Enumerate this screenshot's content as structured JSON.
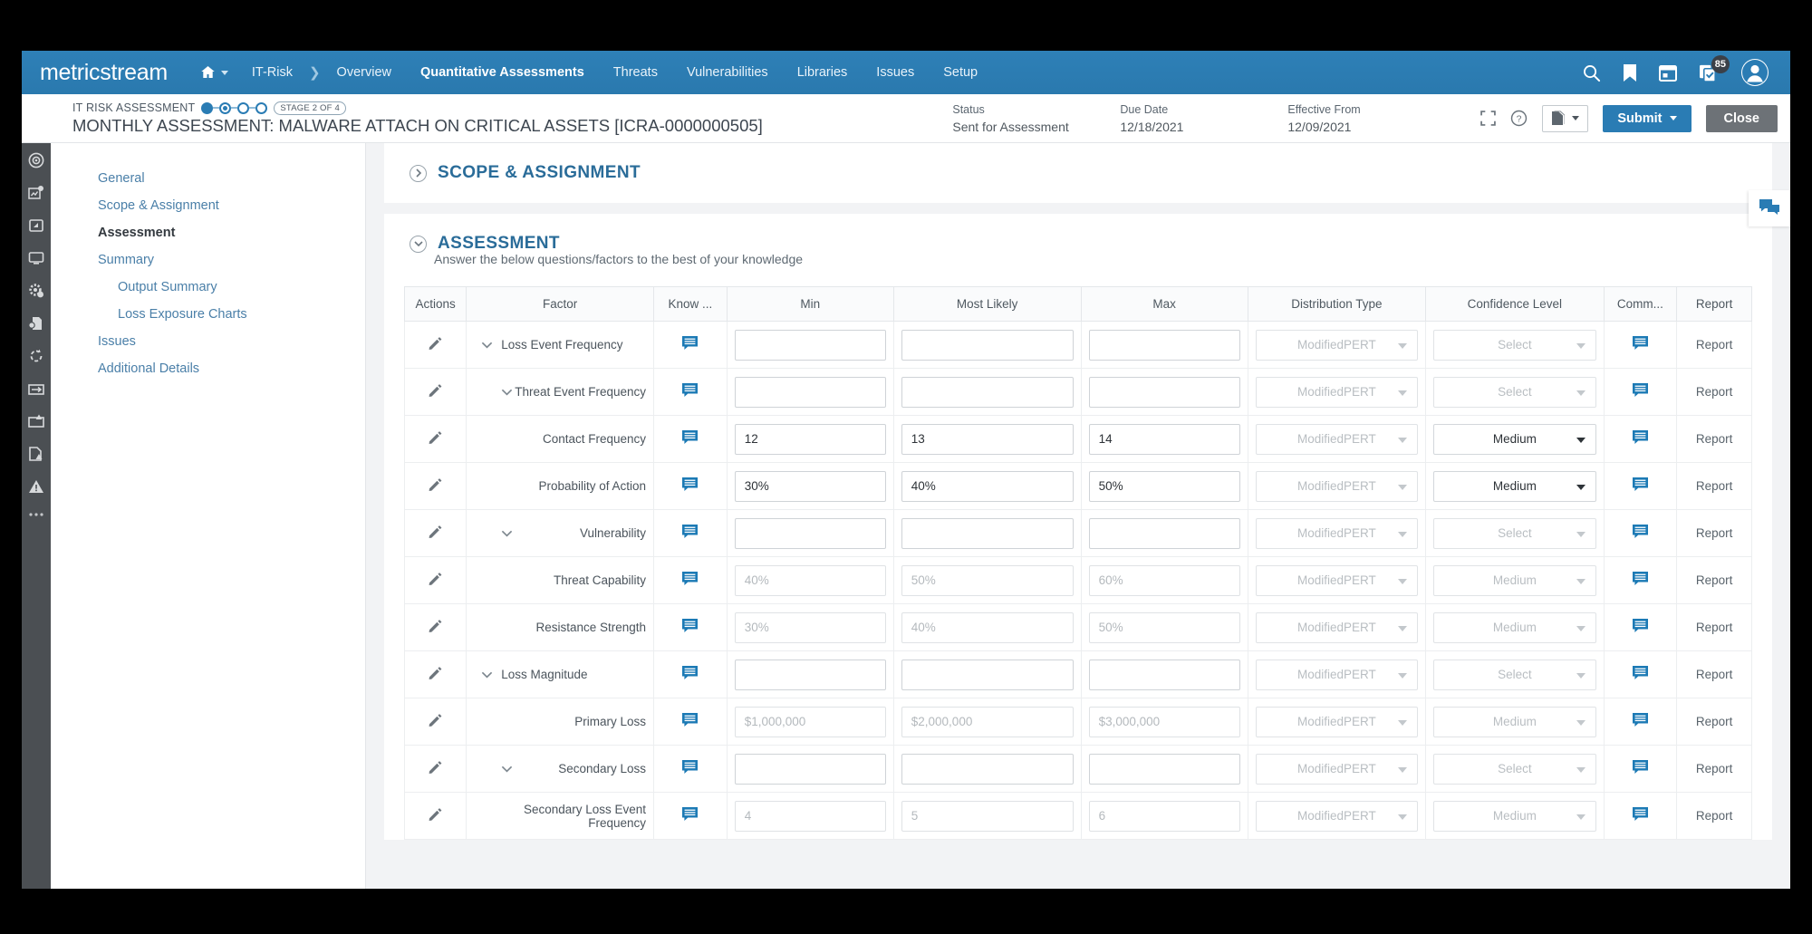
{
  "topnav": {
    "brand": "metricstream",
    "home_label": "home-icon",
    "breadcrumb": [
      "IT-Risk",
      "Overview"
    ],
    "items": [
      {
        "label": "Quantitative Assessments",
        "active": true
      },
      {
        "label": "Threats",
        "active": false
      },
      {
        "label": "Vulnerabilities",
        "active": false
      },
      {
        "label": "Libraries",
        "active": false
      },
      {
        "label": "Issues",
        "active": false
      },
      {
        "label": "Setup",
        "active": false
      }
    ],
    "right_icons": [
      "search-icon",
      "bookmark-icon",
      "calendar-icon",
      "tasks-icon",
      "user-avatar"
    ],
    "task_badge": "85",
    "accent": "#2a7cb4"
  },
  "record_header": {
    "kicker": "IT RISK ASSESSMENT",
    "stage_pill": "STAGE 2 OF 4",
    "stage_total": 4,
    "stage_current": 2,
    "title": "MONTHLY ASSESSMENT: MALWARE ATTACH ON CRITICAL ASSETS [ICRA-0000000505]",
    "meta": [
      {
        "label": "Status",
        "value": "Sent for Assessment"
      },
      {
        "label": "Due Date",
        "value": "12/18/2021"
      },
      {
        "label": "Effective From",
        "value": "12/09/2021"
      }
    ],
    "expand_icon": "expand-icon",
    "help_icon": "help-icon",
    "doc_icon": "document-icon",
    "submit_label": "Submit",
    "close_label": "Close"
  },
  "rail": {
    "icons": [
      "target-icon",
      "risk-assessment-icon",
      "asset-icon",
      "monitor-icon",
      "settings-gear-icon",
      "policy-icon",
      "refresh-cycle-icon",
      "inbox-icon",
      "report-warning-icon",
      "document-alert-icon",
      "warning-triangle-icon",
      "more-icon"
    ]
  },
  "sidebar": {
    "items": [
      {
        "label": "General",
        "current": false,
        "sub": false
      },
      {
        "label": "Scope & Assignment",
        "current": false,
        "sub": false
      },
      {
        "label": "Assessment",
        "current": true,
        "sub": false
      },
      {
        "label": "Summary",
        "current": false,
        "sub": false
      },
      {
        "label": "Output Summary",
        "current": false,
        "sub": true
      },
      {
        "label": "Loss Exposure Charts",
        "current": false,
        "sub": true
      },
      {
        "label": "Issues",
        "current": false,
        "sub": false
      },
      {
        "label": "Additional Details",
        "current": false,
        "sub": false
      }
    ]
  },
  "sections": {
    "scope": {
      "title": "SCOPE & ASSIGNMENT",
      "collapsed": true
    },
    "assessment": {
      "title": "ASSESSMENT",
      "subtitle": "Answer the below questions/factors to the best of your knowledge",
      "collapsed": false
    }
  },
  "chat_fab_icon": "chat-bubble-icon",
  "table": {
    "columns": [
      "Actions",
      "Factor",
      "Know ...",
      "Min",
      "Most Likely",
      "Max",
      "Distribution Type",
      "Confidence Level",
      "Comm...",
      "Report"
    ],
    "report_label": "Report",
    "rows": [
      {
        "factor": "Loss Event Frequency",
        "indent": 1,
        "chevron": true,
        "min": "",
        "likely": "",
        "max": "",
        "dim": false,
        "dist": "ModifiedPERT",
        "dist_dim": true,
        "conf": "Select",
        "conf_dim": true
      },
      {
        "factor": "Threat Event Frequency",
        "indent": 2,
        "chevron": true,
        "min": "",
        "likely": "",
        "max": "",
        "dim": false,
        "dist": "ModifiedPERT",
        "dist_dim": true,
        "conf": "Select",
        "conf_dim": true
      },
      {
        "factor": "Contact Frequency",
        "indent": 3,
        "chevron": false,
        "min": "12",
        "likely": "13",
        "max": "14",
        "dim": false,
        "dist": "ModifiedPERT",
        "dist_dim": true,
        "conf": "Medium",
        "conf_dim": false
      },
      {
        "factor": "Probability of Action",
        "indent": 3,
        "chevron": false,
        "min": "30%",
        "likely": "40%",
        "max": "50%",
        "dim": false,
        "dist": "ModifiedPERT",
        "dist_dim": true,
        "conf": "Medium",
        "conf_dim": false
      },
      {
        "factor": "Vulnerability",
        "indent": 2,
        "chevron": true,
        "min": "",
        "likely": "",
        "max": "",
        "dim": false,
        "dist": "ModifiedPERT",
        "dist_dim": true,
        "conf": "Select",
        "conf_dim": true
      },
      {
        "factor": "Threat Capability",
        "indent": 3,
        "chevron": false,
        "min": "40%",
        "likely": "50%",
        "max": "60%",
        "dim": true,
        "dist": "ModifiedPERT",
        "dist_dim": true,
        "conf": "Medium",
        "conf_dim": true
      },
      {
        "factor": "Resistance Strength",
        "indent": 3,
        "chevron": false,
        "min": "30%",
        "likely": "40%",
        "max": "50%",
        "dim": true,
        "dist": "ModifiedPERT",
        "dist_dim": true,
        "conf": "Medium",
        "conf_dim": true
      },
      {
        "factor": "Loss Magnitude",
        "indent": 1,
        "chevron": true,
        "min": "",
        "likely": "",
        "max": "",
        "dim": false,
        "dist": "ModifiedPERT",
        "dist_dim": true,
        "conf": "Select",
        "conf_dim": true
      },
      {
        "factor": "Primary Loss",
        "indent": 3,
        "chevron": false,
        "min": "$1,000,000",
        "likely": "$2,000,000",
        "max": "$3,000,000",
        "dim": true,
        "dist": "ModifiedPERT",
        "dist_dim": true,
        "conf": "Medium",
        "conf_dim": true
      },
      {
        "factor": "Secondary Loss",
        "indent": 2,
        "chevron": true,
        "min": "",
        "likely": "",
        "max": "",
        "dim": false,
        "dist": "ModifiedPERT",
        "dist_dim": true,
        "conf": "Select",
        "conf_dim": true
      },
      {
        "factor": "Secondary Loss Event Frequency",
        "indent": 3,
        "chevron": false,
        "min": "4",
        "likely": "5",
        "max": "6",
        "dim": true,
        "dist": "ModifiedPERT",
        "dist_dim": true,
        "conf": "Medium",
        "conf_dim": true
      }
    ]
  }
}
